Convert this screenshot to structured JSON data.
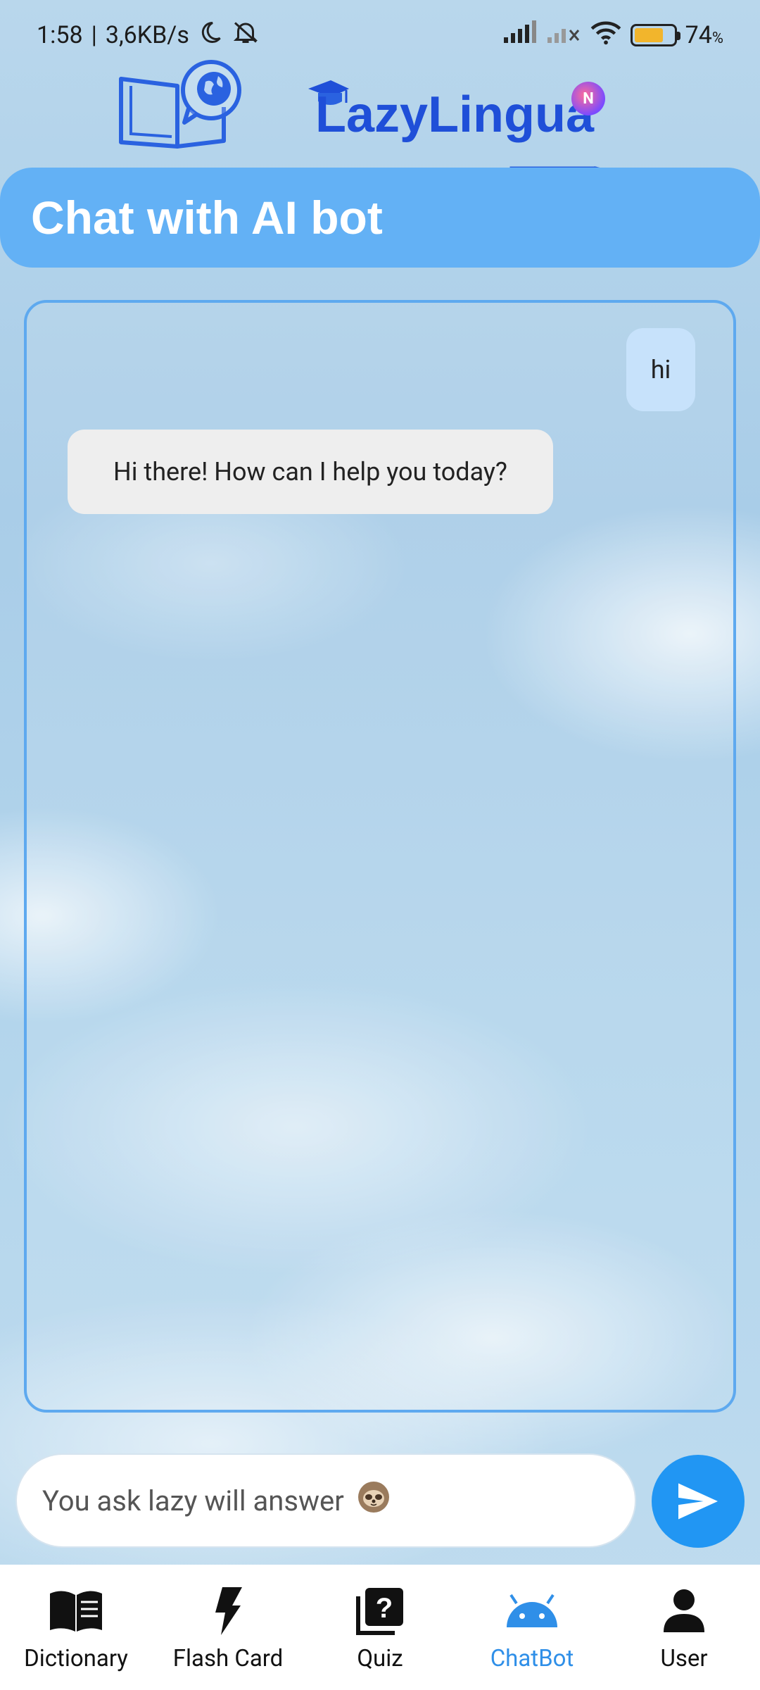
{
  "status_bar": {
    "time": "1:58",
    "speed": "3,6KB/s",
    "battery_percent": "74",
    "battery_symbol": "%",
    "battery_level": 0.74
  },
  "header": {
    "brand": "LazyLingua",
    "badge": "N"
  },
  "page_title": "Chat with AI bot",
  "chat": {
    "messages": [
      {
        "sender": "user",
        "text": "hi"
      },
      {
        "sender": "bot",
        "text": "Hi there! How can I help you today?"
      }
    ]
  },
  "input": {
    "placeholder": "You ask lazy will answer"
  },
  "nav": {
    "items": [
      {
        "label": "Dictionary",
        "icon": "book-icon"
      },
      {
        "label": "Flash Card",
        "icon": "flash-icon"
      },
      {
        "label": "Quiz",
        "icon": "quiz-icon"
      },
      {
        "label": "ChatBot",
        "icon": "android-icon",
        "active": true
      },
      {
        "label": "User",
        "icon": "person-icon"
      }
    ]
  },
  "colors": {
    "accent": "#2196f3",
    "banner": "#63b1f5",
    "brand": "#1f4fd8",
    "active_nav": "#2f8fe8"
  }
}
